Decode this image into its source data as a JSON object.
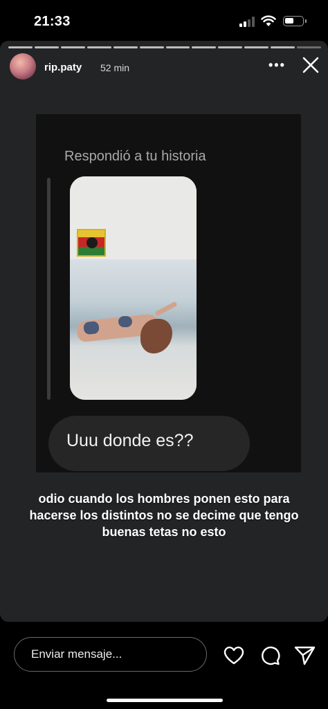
{
  "status_bar": {
    "time": "21:33"
  },
  "story": {
    "segments_total": 12,
    "segments_viewed": 11,
    "user": {
      "username": "rip.paty",
      "time_ago": "52 min"
    },
    "dm": {
      "reply_label": "Respondió a tu historia",
      "message": "Uuu donde es??"
    },
    "caption": "odio cuando los hombres ponen esto para hacerse los distintos no se decime que tengo buenas tetas no esto"
  },
  "composer": {
    "placeholder": "Enviar mensaje..."
  },
  "icons": [
    "more-icon",
    "close-icon",
    "heart-icon",
    "comment-icon",
    "send-icon"
  ]
}
